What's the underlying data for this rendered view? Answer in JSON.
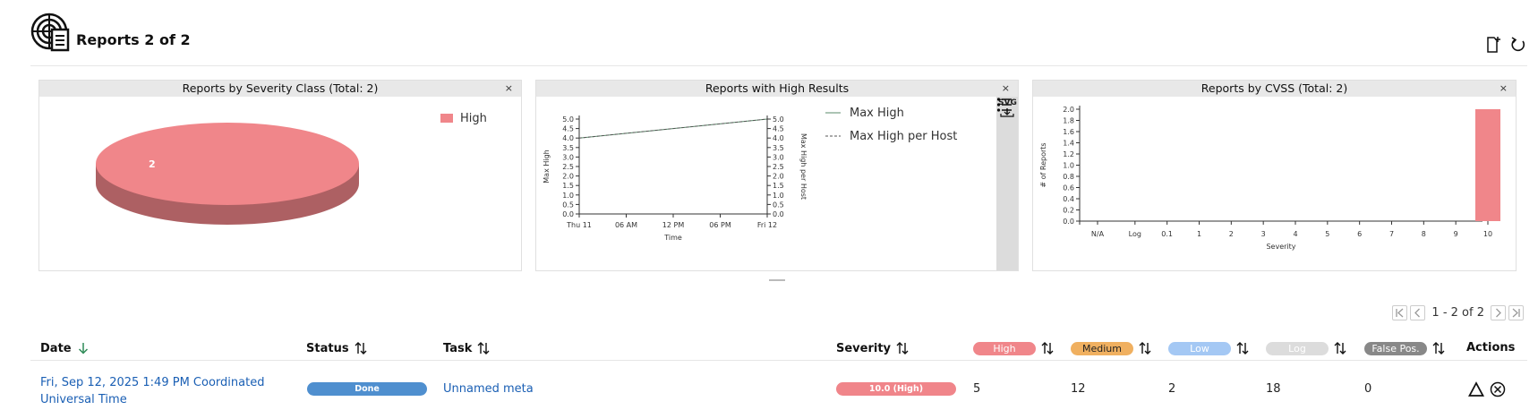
{
  "header": {
    "title": "Reports 2 of 2",
    "icons": [
      "reports-radar-icon",
      "new-report-icon",
      "reload-icon"
    ]
  },
  "dashboard": {
    "close_label": "×",
    "panels": [
      {
        "title": "Reports by Severity Class (Total: 2)",
        "chart_data": {
          "type": "pie",
          "slices": [
            {
              "label": "High",
              "value": 2,
              "color": "#f0868a"
            }
          ],
          "legend_position": "top-right"
        }
      },
      {
        "title": "Reports with High Results",
        "tools": {
          "svg_label": "SVG",
          "download_icon": "download-icon",
          "legend_icon": "legend-list-icon"
        },
        "chart_data": {
          "type": "line",
          "x": [
            "Thu 11",
            "06 AM",
            "12 PM",
            "06 PM",
            "Fri 12"
          ],
          "series": [
            {
              "name": "Max High",
              "values": [
                4.0,
                null,
                null,
                null,
                5.0
              ],
              "color": "#5a8a6a",
              "dash": "solid"
            },
            {
              "name": "Max High per Host",
              "values": [
                4.0,
                null,
                null,
                null,
                5.0
              ],
              "color": "#555555",
              "dash": "dashed"
            }
          ],
          "xlabel": "Time",
          "ylabel": "Max High",
          "y2label": "Max High per Host",
          "ylim": [
            0,
            5
          ],
          "yticks": [
            "0.0",
            "0.5",
            "1.0",
            "1.5",
            "2.0",
            "2.5",
            "3.0",
            "3.5",
            "4.0",
            "4.5",
            "5.0"
          ]
        }
      },
      {
        "title": "Reports by CVSS (Total: 2)",
        "chart_data": {
          "type": "bar",
          "categories": [
            "N/A",
            "Log",
            "0.1",
            "1",
            "2",
            "3",
            "4",
            "5",
            "6",
            "7",
            "8",
            "9",
            "10"
          ],
          "values": [
            0,
            0,
            0,
            0,
            0,
            0,
            0,
            0,
            0,
            0,
            0,
            0,
            2
          ],
          "color": "#f0868a",
          "xlabel": "Severity",
          "ylabel": "# of Reports",
          "ylim": [
            0,
            2
          ],
          "yticks": [
            "0.0",
            "0.2",
            "0.4",
            "0.6",
            "0.8",
            "1.0",
            "1.2",
            "1.4",
            "1.6",
            "1.8",
            "2.0"
          ]
        }
      }
    ]
  },
  "pagination": {
    "text": "1 - 2 of 2"
  },
  "table": {
    "columns": {
      "date": "Date",
      "status": "Status",
      "task": "Task",
      "severity": "Severity",
      "high": "High",
      "medium": "Medium",
      "low": "Low",
      "log": "Log",
      "false_pos": "False Pos.",
      "actions": "Actions"
    },
    "badge_colors": {
      "high": "#f0868a",
      "medium": "#f0b060",
      "low": "#a4c8f4",
      "log": "#dcdcdc",
      "false_pos": "#888888"
    },
    "rows": [
      {
        "date_line1": "Fri, Sep 12, 2025 1:49 PM Coordinated",
        "date_line2": "Universal Time",
        "status": "Done",
        "task": "Unnamed meta",
        "severity": "10.0 (High)",
        "high": "5",
        "medium": "12",
        "low": "2",
        "log": "18",
        "false_pos": "0"
      }
    ]
  }
}
